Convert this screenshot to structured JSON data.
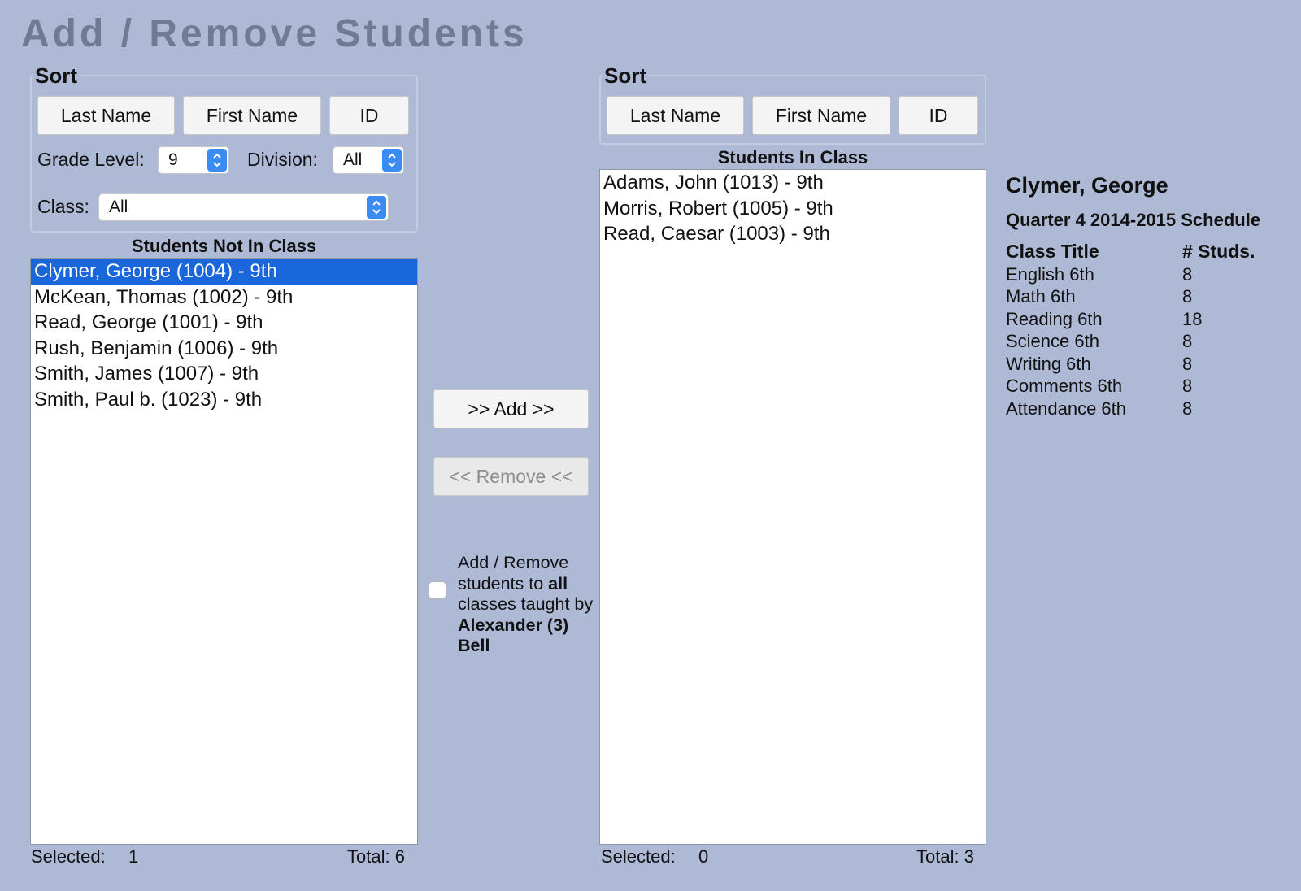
{
  "title": "Add / Remove Students",
  "left_panel": {
    "sort_label": "Sort",
    "sort_buttons": [
      "Last Name",
      "First Name",
      "ID"
    ],
    "grade_label": "Grade Level:",
    "grade_value": "9",
    "division_label": "Division:",
    "division_value": "All",
    "class_label": "Class:",
    "class_value": "All",
    "list_title": "Students Not In Class",
    "students": [
      "Clymer, George (1004) - 9th",
      "McKean, Thomas (1002) - 9th",
      "Read, George (1001) - 9th",
      "Rush, Benjamin (1006) - 9th",
      "Smith, James (1007) - 9th",
      "Smith, Paul  b. (1023) - 9th"
    ],
    "selected_label": "Selected:",
    "selected_count": "1",
    "total_label": "Total: 6"
  },
  "middle": {
    "add_label": ">> Add >>",
    "remove_label": "<< Remove <<",
    "note_part1": "Add / Remove students to",
    "note_bold1": "all",
    "note_part2": "classes taught by",
    "note_bold2": "Alexander (3) Bell"
  },
  "right_panel": {
    "sort_label": "Sort",
    "sort_buttons": [
      "Last Name",
      "First Name",
      "ID"
    ],
    "list_title": "Students In Class",
    "students": [
      "Adams, John (1013) - 9th",
      "Morris, Robert (1005) - 9th",
      "Read, Caesar (1003) - 9th"
    ],
    "selected_label": "Selected:",
    "selected_count": "0",
    "total_label": "Total: 3"
  },
  "schedule": {
    "student_name": "Clymer, George",
    "subtitle": "Quarter 4 2014-2015 Schedule",
    "col_class": "Class Title",
    "col_count": "# Studs.",
    "rows": [
      {
        "title": "English 6th",
        "count": "8"
      },
      {
        "title": "Math 6th",
        "count": "8"
      },
      {
        "title": "Reading 6th",
        "count": "18"
      },
      {
        "title": "Science 6th",
        "count": "8"
      },
      {
        "title": "Writing 6th",
        "count": "8"
      },
      {
        "title": "Comments 6th",
        "count": "8"
      },
      {
        "title": "Attendance 6th",
        "count": "8"
      }
    ]
  },
  "colors": {
    "background": "#aeb9d6",
    "selection": "#1a66db",
    "stepper": "#3b8cf2",
    "title": "#6f7a93"
  }
}
